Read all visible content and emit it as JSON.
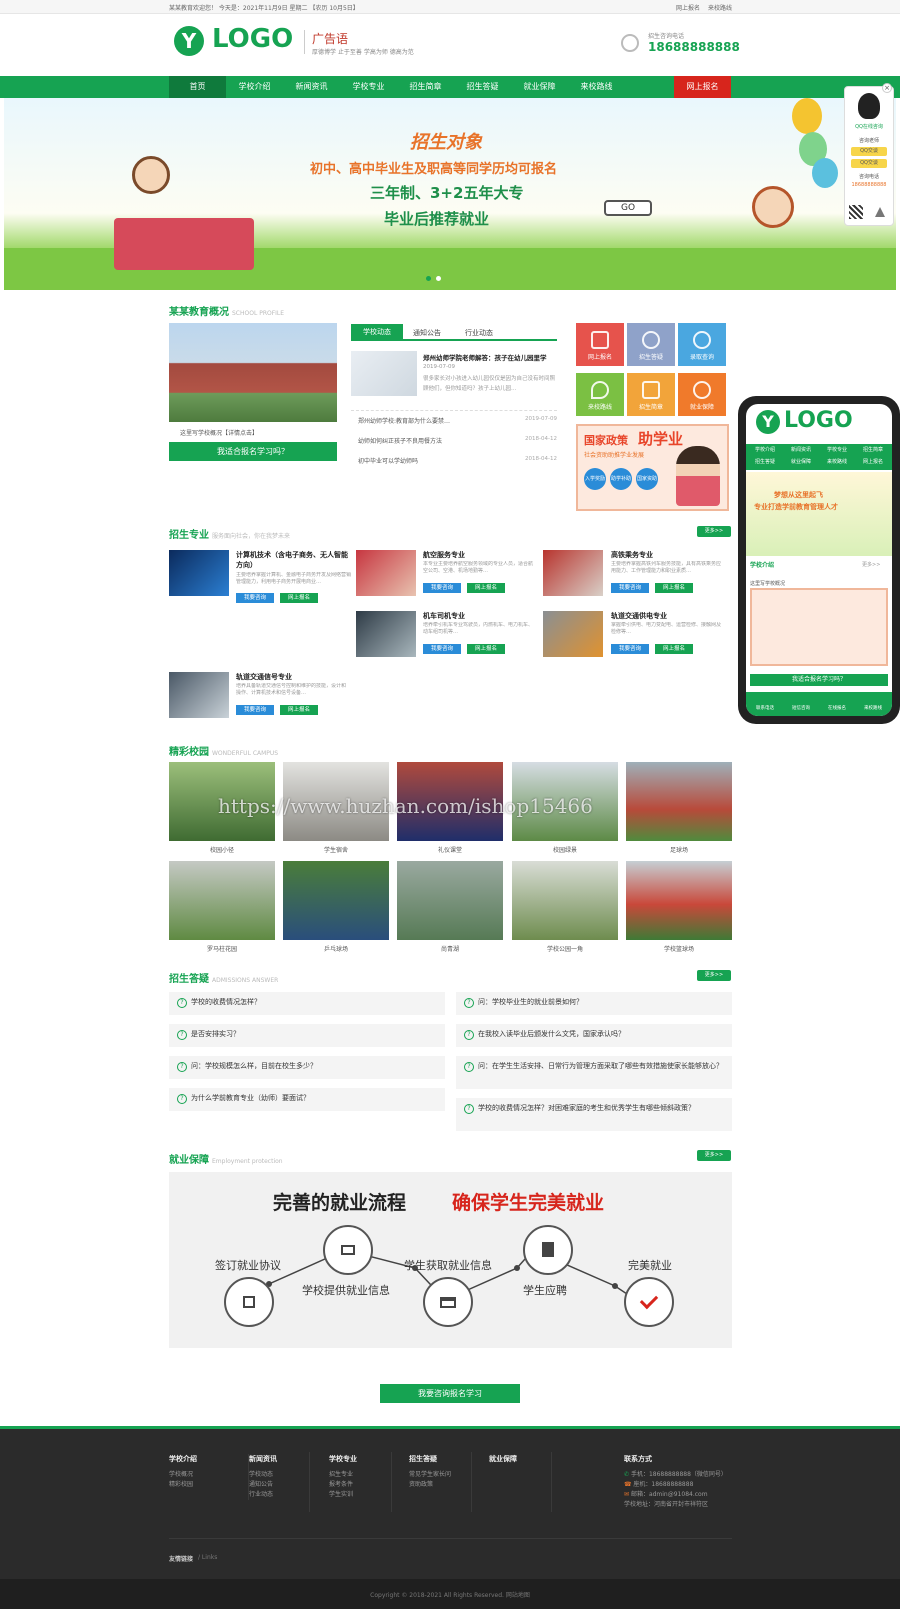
{
  "topbar": {
    "welcome": "某某教育欢迎您！ 今天是：2021年11月9日 星期二 【农历 10月5日】",
    "links": [
      "网上报名",
      "来校路线"
    ]
  },
  "header": {
    "logo": "LOGO",
    "slogan_title": "广告语",
    "slogan_sub": "厚德博学 止于至善 学高为师 德高为范",
    "phone_label": "招生咨询电话",
    "phone": "18688888888"
  },
  "nav": {
    "items": [
      "首页",
      "学校介绍",
      "新闻资讯",
      "学校专业",
      "招生简章",
      "招生答疑",
      "就业保障",
      "来校路线"
    ],
    "apply": "网上报名"
  },
  "banner": {
    "line1": "招生对象",
    "line2": "初中、高中毕业生及职高等同学历均可报名",
    "line3": "三年制、3+2五年大专",
    "line4": "毕业后推荐就业",
    "sign": "GO"
  },
  "qq_float": {
    "title": "QQ在线咨询",
    "teacher": "咨询老师",
    "btn1": "QQ交谈",
    "btn2": "QQ交谈",
    "tel_label": "咨询电话",
    "tel": "18688888888"
  },
  "profile": {
    "title": "某某教育概况",
    "title_en": "SCHOOL PROFILE",
    "caption": "这里写学校概况【详情点击】",
    "btn": "我适合报名学习吗？"
  },
  "news": {
    "tabs": [
      "学校动态",
      "通知公告",
      "行业动态"
    ],
    "feature_title": "郑州幼师学院老师解答：孩子在幼儿园里学",
    "feature_date": "2019-07-09",
    "feature_text": "很多家长对小孩进入幼儿园仅仅是因为自己没有时间照顾他们，但你知道吗？孩子上幼儿园…",
    "list": [
      {
        "t": "郑州幼师学校:教育部为什么要禁…",
        "d": "2019-07-09"
      },
      {
        "t": "幼师如何纠正孩子不良用餐方法",
        "d": "2018-04-12"
      },
      {
        "t": "初中毕业可以学幼师吗",
        "d": "2018-04-12"
      }
    ]
  },
  "tiles": [
    {
      "l": "网上报名",
      "c": "#e6534c"
    },
    {
      "l": "招生答疑",
      "c": "#8fa2c9"
    },
    {
      "l": "录取查询",
      "c": "#4aa7e0"
    },
    {
      "l": "来校路线",
      "c": "#7bc043"
    },
    {
      "l": "招生简章",
      "c": "#f2a43a"
    },
    {
      "l": "就业保障",
      "c": "#f07a2b"
    }
  ],
  "policy": {
    "title_a": "国家政策",
    "title_b": "助学业",
    "sub": "社会资助助推学业发展",
    "chips": [
      "入学奖励",
      "助学补助",
      "国家资助"
    ]
  },
  "majors": {
    "title": "招生专业",
    "title_en": "服务面向社会，你在我梦未来",
    "more": "更多>>",
    "consult": "我要咨询",
    "apply": "网上报名",
    "items": [
      {
        "name": "计算机技术（含电子商务、无人智能方向）",
        "desc": "主要培养掌握计算机、金融电子商务开发及网络营销管理能力，利用电子商务开展电商业…"
      },
      {
        "name": "航空服务专业",
        "desc": "本专业主要培养航空服务领域的专业人员，适合航空公司、空港、机场地勤等…"
      },
      {
        "name": "高铁乘务专业",
        "desc": "主要培养掌握高铁列车服务技能，具有高铁乘务应用能力、工作管理能力和职业素质…"
      },
      {
        "name": "机车司机专业",
        "desc": "培养牵引机车专业驾驶员，内燃机车、电力机车、动车组司机等…"
      },
      {
        "name": "轨道交通供电专业",
        "desc": "掌握牵引供电、电力变配电、运营检修、接触网及检修等…"
      },
      {
        "name": "轨道交通信号专业",
        "desc": "培养具备轨道交通信号控制和维护的技能，设计和操作、计算机技术和信号设备…"
      }
    ]
  },
  "campus": {
    "title": "精彩校园",
    "title_en": "WONDERFUL CAMPUS",
    "items": [
      "校园小径",
      "学生宿舍",
      "礼仪课堂",
      "校园绿景",
      "足球场",
      "罗马柱花园",
      "乒乓球场",
      "尚青湖",
      "学校公园一角",
      "学校篮球场"
    ],
    "watermark": "https://www.huzhan.com/ishop15466"
  },
  "qa": {
    "title": "招生答疑",
    "title_en": "ADMISSIONS ANSWER",
    "more": "更多>>",
    "left": [
      "学校的收费情况怎样？",
      "是否安排实习？",
      "问：学校规模怎么样，目前在校生多少？",
      "为什么学前教育专业（幼师）要面试？"
    ],
    "right": [
      "问：学校毕业生的就业前景如何？",
      "在我校入读毕业后颁发什么文凭，国家承认吗？",
      "问：在学生生活安排、日常行为管理方面采取了哪些有效措施使家长能够放心？",
      "学校的收费情况怎样？对困难家庭的考生和优秀学生有哪些倾斜政策？"
    ]
  },
  "employ": {
    "title": "就业保障",
    "title_en": "Employment protection",
    "more": "更多>>",
    "head_a": "完善的就业流程",
    "head_b": "确保学生完美就业",
    "steps": [
      "签订就业协议",
      "学校提供就业信息",
      "学生获取就业信息",
      "学生应聘",
      "完美就业"
    ]
  },
  "cta": "我要咨询报名学习",
  "mobile": {
    "logo": "LOGO",
    "nav": [
      "学校介绍",
      "新闻资讯",
      "学校专业",
      "招生简章",
      "招生答疑",
      "就业保障",
      "来校路线",
      "网上报名"
    ],
    "banner1": "梦想从这里起飞",
    "banner2": "专业打造学前教育管理人才",
    "sec": "学校介绍",
    "more": "更多>>",
    "intro": "这里写学校概况",
    "bar": "我适合报名学习吗？",
    "bottom": [
      "联系电话",
      "短信咨询",
      "在线报名",
      "来校路线"
    ]
  },
  "footer": {
    "cols": [
      {
        "h": "学校介绍",
        "i": [
          "学校概况",
          "精彩校园"
        ]
      },
      {
        "h": "新闻资讯",
        "i": [
          "学校动态",
          "通知公告",
          "行业动态"
        ]
      },
      {
        "h": "学校专业",
        "i": [
          "招生专业",
          "报考条件",
          "学生实训"
        ]
      },
      {
        "h": "招生答疑",
        "i": [
          "常见学生家长问",
          "资助政策"
        ]
      },
      {
        "h": "就业保障",
        "i": []
      }
    ],
    "contact_title": "联系方式",
    "contact": [
      "手机：18688888888（微信同号）",
      "座机：18688888888",
      "邮箱：admin@91084.com",
      "学校地址：河南省开封市祥符区"
    ],
    "links_label": "友情链接",
    "links_sub": "/ Links",
    "copyright": "Copyright © 2018-2021 All Rights Reserved.  网站地图"
  }
}
